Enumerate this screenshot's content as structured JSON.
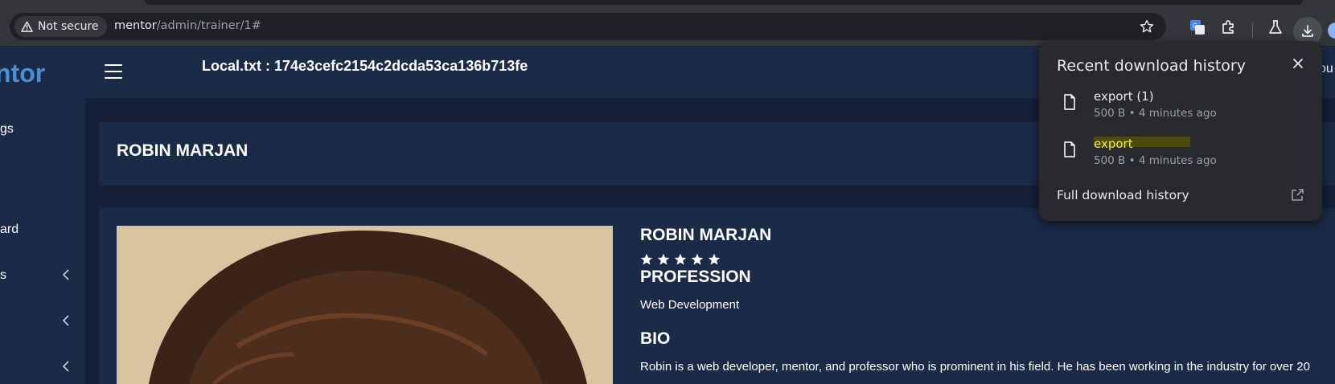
{
  "browser": {
    "security_label": "Not secure",
    "url_host": "mentor",
    "url_path": "/admin/trainer/1#"
  },
  "header": {
    "brand": "ntor",
    "local_txt": "Local.txt : 174e3cefc2154c2dcda53ca136b713fe",
    "right_text": "ou"
  },
  "sidebar": {
    "items": [
      {
        "label": "gs"
      },
      {
        "label": "ard"
      },
      {
        "label": "s"
      }
    ]
  },
  "trainer": {
    "card_title": "ROBIN MARJAN",
    "name": "ROBIN MARJAN",
    "rating": 5,
    "profession_heading": "PROFESSION",
    "profession": "Web Development",
    "bio_heading": "BIO",
    "bio": "Robin is a web developer, mentor, and professor who is prominent in his field. He has been working in the industry for over 20"
  },
  "download_popup": {
    "title": "Recent download history",
    "items": [
      {
        "name": "export (1)",
        "meta": "500 B • 4 minutes ago"
      },
      {
        "name": "export",
        "meta": "500 B • 4 minutes ago"
      }
    ],
    "full_history_label": "Full download history"
  },
  "colors": {
    "page_bg": "#1b2a47",
    "content_bg": "#152038",
    "brand": "#4a8fd6",
    "popup_bg": "#292a2d",
    "highlight": "#f5e642"
  }
}
